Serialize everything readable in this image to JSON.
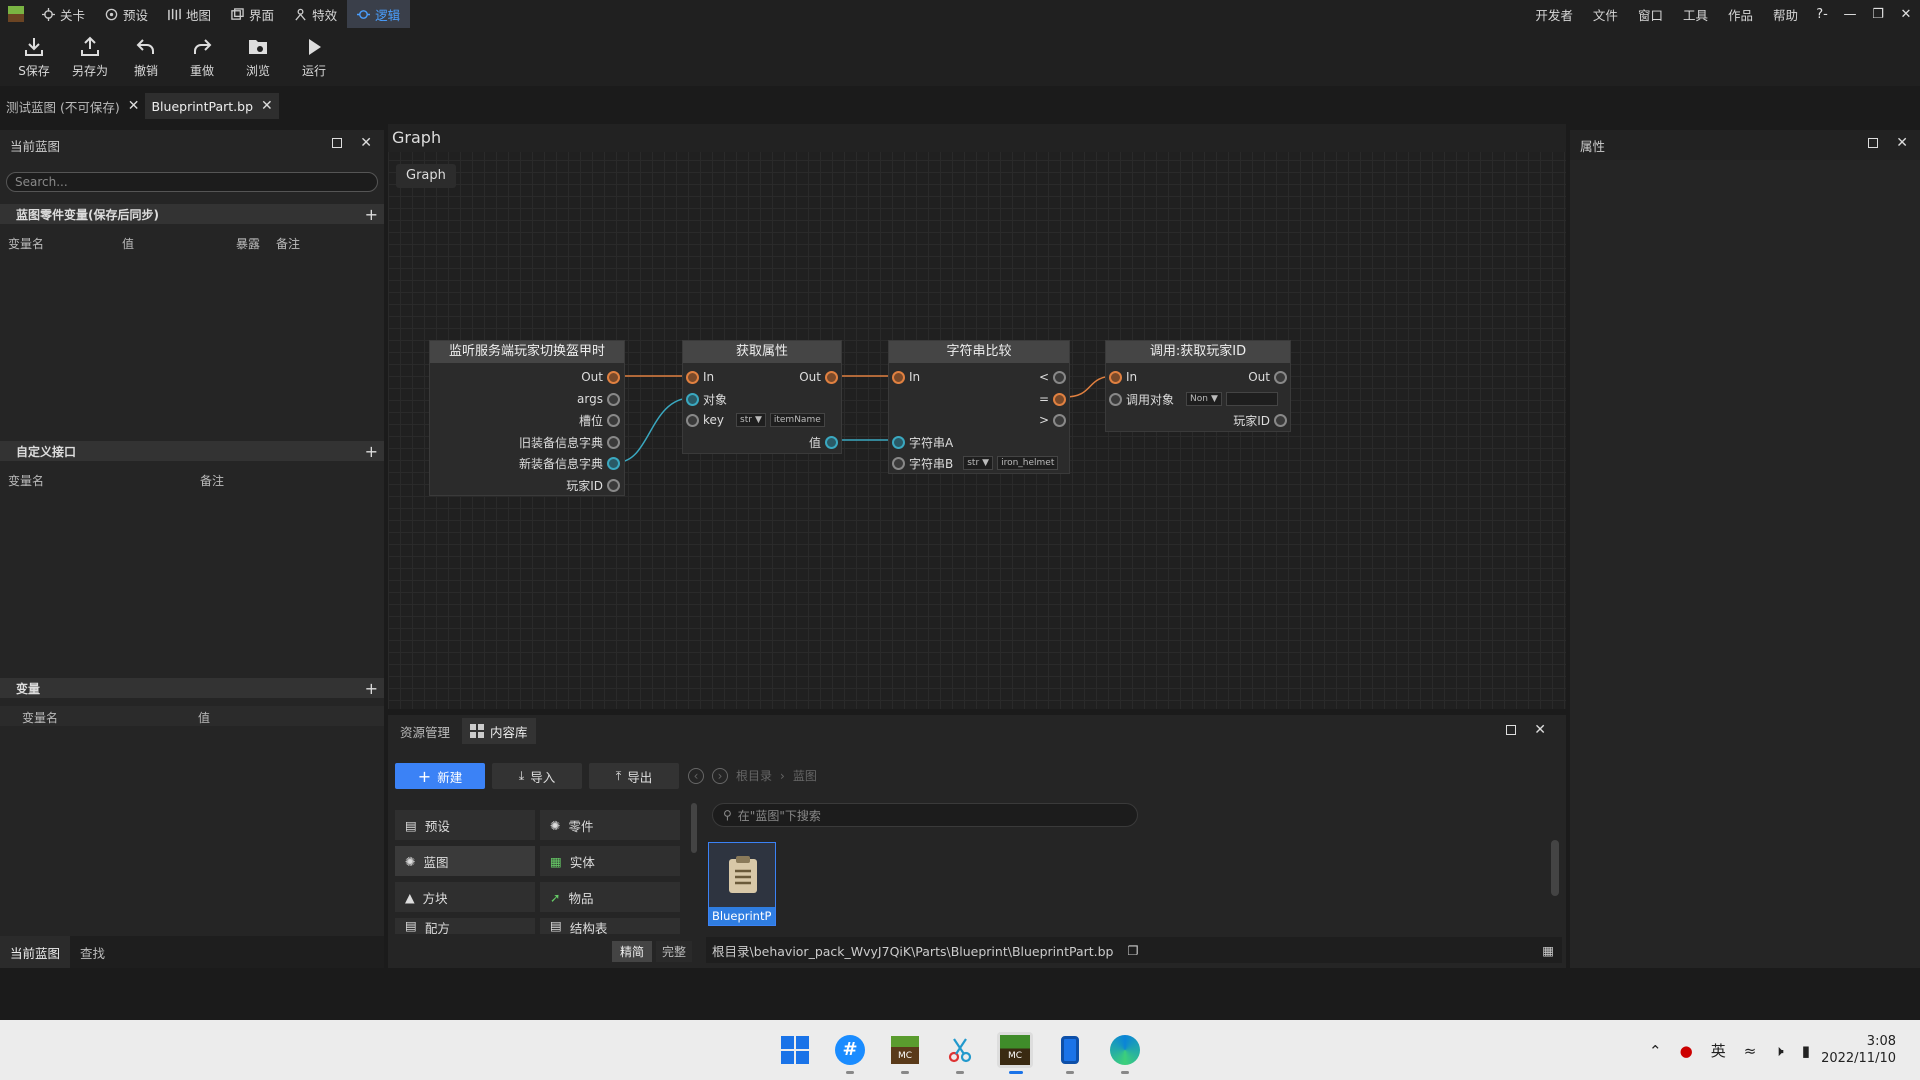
{
  "menubar": {
    "tabs": [
      {
        "label": "关卡",
        "icon": "crosshair-icon"
      },
      {
        "label": "预设",
        "icon": "preset-icon"
      },
      {
        "label": "地图",
        "icon": "map-icon"
      },
      {
        "label": "界面",
        "icon": "ui-icon"
      },
      {
        "label": "特效",
        "icon": "effects-icon"
      },
      {
        "label": "逻辑",
        "icon": "logic-icon",
        "active": true
      }
    ],
    "right_items": [
      "开发者",
      "文件",
      "窗口",
      "工具",
      "作品",
      "帮助"
    ],
    "help_glyph": "?-"
  },
  "toolbar": {
    "buttons": [
      {
        "label": "S保存",
        "icon": "save-icon"
      },
      {
        "label": "另存为",
        "icon": "save-as-icon"
      },
      {
        "label": "撤销",
        "icon": "undo-icon"
      },
      {
        "label": "重做",
        "icon": "redo-icon"
      },
      {
        "label": "浏览",
        "icon": "browse-icon"
      },
      {
        "label": "运行",
        "icon": "play-icon"
      }
    ]
  },
  "doc_tabs": [
    {
      "label": "测试蓝图 (不可保存)",
      "active": false
    },
    {
      "label": "BlueprintPart.bp",
      "active": true
    }
  ],
  "left_panel": {
    "title": "当前蓝图",
    "search_placeholder": "Search...",
    "section1": {
      "title": "蓝图零件变量(保存后同步)",
      "cols": [
        "变量名",
        "值",
        "暴露",
        "备注"
      ]
    },
    "section2": {
      "title": "自定义接口",
      "cols": [
        "变量名",
        "备注"
      ]
    },
    "section3": {
      "title": "变量",
      "cols": [
        "变量名",
        "值"
      ]
    },
    "bottom_tabs": [
      "当前蓝图",
      "查找"
    ]
  },
  "graph": {
    "header": "Graph",
    "chip": "Graph",
    "nodes": {
      "event": {
        "title": "监听服务端玩家切换盔甲时",
        "pins": [
          "Out",
          "args",
          "槽位",
          "旧装备信息字典",
          "新装备信息字典",
          "玩家ID"
        ]
      },
      "getprop": {
        "title": "获取属性",
        "pin_in": "In",
        "pin_out": "Out",
        "pin_obj": "对象",
        "pin_key": "key",
        "key_type": "str",
        "key_value": "itemName",
        "pin_value": "值"
      },
      "strcmp": {
        "title": "字符串比较",
        "pin_in": "In",
        "lt": "<",
        "eq": "=",
        "gt": ">",
        "pin_a": "字符串A",
        "pin_b": "字符串B",
        "b_type": "str",
        "b_value": "iron_helmet"
      },
      "getplayer": {
        "title": "调用:获取玩家ID",
        "pin_in": "In",
        "pin_out": "Out",
        "pin_target": "调用对象",
        "target_value": "Non",
        "pin_player": "玩家ID"
      }
    }
  },
  "right_panel": {
    "title": "属性"
  },
  "bottom_panel": {
    "tabs": [
      {
        "label": "资源管理",
        "active": false
      },
      {
        "label": "内容库",
        "active": true
      }
    ],
    "buttons": {
      "new": "新建",
      "import": "导入",
      "export": "导出"
    },
    "breadcrumb": [
      "根目录",
      "蓝图"
    ],
    "categories": [
      {
        "label": "预设",
        "icon": "preset-icon"
      },
      {
        "label": "零件",
        "icon": "part-icon"
      },
      {
        "label": "蓝图",
        "icon": "blueprint-icon",
        "active": true
      },
      {
        "label": "实体",
        "icon": "entity-icon"
      },
      {
        "label": "方块",
        "icon": "block-icon"
      },
      {
        "label": "物品",
        "icon": "item-icon"
      },
      {
        "label": "配方",
        "icon": "recipe-icon"
      },
      {
        "label": "结构表",
        "icon": "table-icon"
      }
    ],
    "search_placeholder": "在\"蓝图\"下搜索",
    "asset": {
      "label": "BlueprintP"
    },
    "view_toggle": [
      "精简",
      "完整"
    ],
    "path": "根目录\\behavior_pack_WvyJ7QiK\\Parts\\Blueprint\\BlueprintPart.bp"
  },
  "taskbar": {
    "tray_lang": "英",
    "time": "3:08",
    "date": "2022/11/10"
  }
}
